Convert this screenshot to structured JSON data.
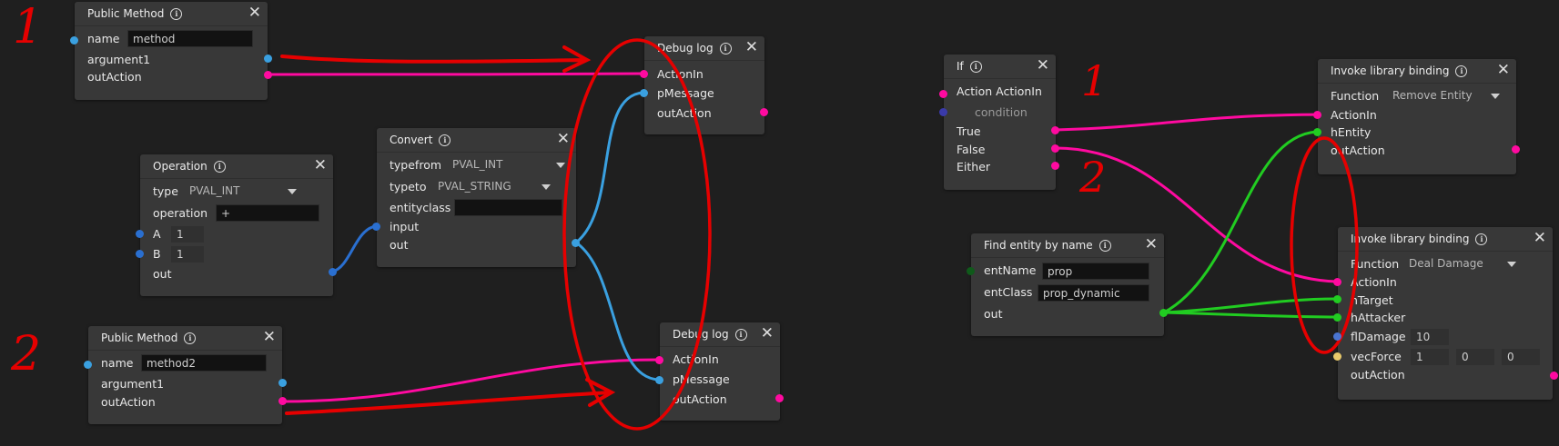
{
  "colors": {
    "action_wire": "#ff0aa0",
    "value_wire": "#3aa0e0",
    "int_wire": "#2a6fd0",
    "entity_wire": "#21cc21",
    "annotation": "#e60000",
    "background": "#1f1f1f",
    "node_bg": "#383838"
  },
  "annotations": [
    "1",
    "2",
    "1",
    "2"
  ],
  "nodes": {
    "public_method_1": {
      "title": "Public Method",
      "name_label": "name",
      "name_value": "method",
      "argument_label": "argument1",
      "out_action_label": "outAction"
    },
    "public_method_2": {
      "title": "Public Method",
      "name_label": "name",
      "name_value": "method2",
      "argument_label": "argument1",
      "out_action_label": "outAction"
    },
    "operation": {
      "title": "Operation",
      "type_label": "type",
      "type_value": "PVAL_INT",
      "operation_label": "operation",
      "operation_value": "+",
      "a_label": "A",
      "a_value": "1",
      "b_label": "B",
      "b_value": "1",
      "out_label": "out"
    },
    "convert": {
      "title": "Convert",
      "typefrom_label": "typefrom",
      "typefrom_value": "PVAL_INT",
      "typeto_label": "typeto",
      "typeto_value": "PVAL_STRING",
      "entityclass_label": "entityclass",
      "entityclass_value": "",
      "input_label": "input",
      "out_label": "out"
    },
    "debug_log_1": {
      "title": "Debug log",
      "action_in_label": "ActionIn",
      "message_label": "pMessage",
      "out_action_label": "outAction"
    },
    "debug_log_2": {
      "title": "Debug log",
      "action_in_label": "ActionIn",
      "message_label": "pMessage",
      "out_action_label": "outAction"
    },
    "if_node": {
      "title": "If",
      "action_in_label": "Action ActionIn",
      "condition_label": "condition",
      "true_label": "True",
      "false_label": "False",
      "either_label": "Either"
    },
    "find_entity": {
      "title": "Find entity by name",
      "ent_name_label": "entName",
      "ent_name_value": "prop",
      "ent_class_label": "entClass",
      "ent_class_value": "prop_dynamic",
      "out_label": "out"
    },
    "invoke_remove": {
      "title": "Invoke library binding",
      "function_label": "Function",
      "function_value": "Remove Entity",
      "action_in_label": "ActionIn",
      "h_entity_label": "hEntity",
      "out_action_label": "outAction"
    },
    "invoke_damage": {
      "title": "Invoke library binding",
      "function_label": "Function",
      "function_value": "Deal Damage",
      "action_in_label": "ActionIn",
      "h_target_label": "hTarget",
      "h_attacker_label": "hAttacker",
      "fl_damage_label": "flDamage",
      "fl_damage_value": "10",
      "vec_force_label": "vecForce",
      "vec_force_x": "1",
      "vec_force_y": "0",
      "vec_force_z": "0",
      "out_action_label": "outAction"
    }
  }
}
